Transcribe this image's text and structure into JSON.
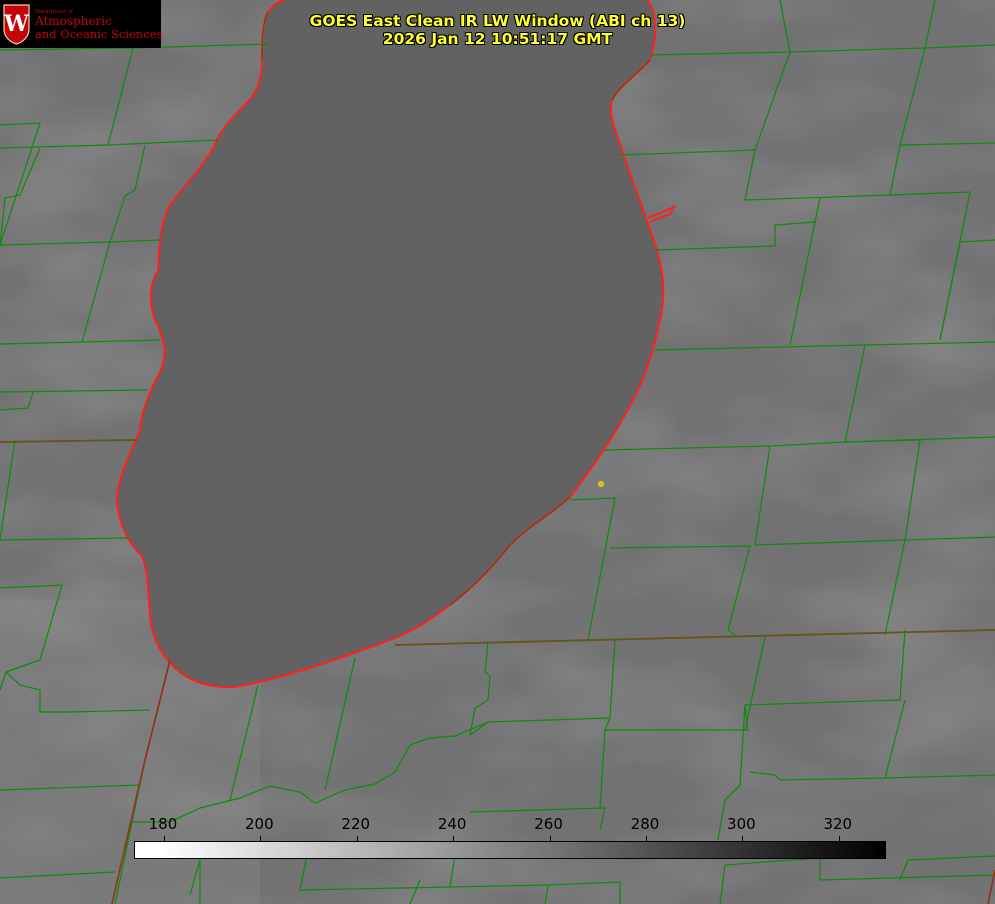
{
  "title_line1": "GOES East Clean IR LW Window (ABI ch 13)",
  "title_line2": "2026 Jan 12 10:51:17 GMT",
  "logo": {
    "department": "Department of",
    "line1": "Atmospheric",
    "line2": "and Oceanic Sciences",
    "seal_letter": "W"
  },
  "colorbar": {
    "ticks": [
      {
        "label": "180",
        "value": 180
      },
      {
        "label": "200",
        "value": 200
      },
      {
        "label": "220",
        "value": 220
      },
      {
        "label": "240",
        "value": 240
      },
      {
        "label": "260",
        "value": 260
      },
      {
        "label": "280",
        "value": 280
      },
      {
        "label": "300",
        "value": 300
      },
      {
        "label": "320",
        "value": 320
      }
    ],
    "min_value": 174,
    "max_value": 330,
    "gradient_from": "#ffffff",
    "gradient_to": "#000000"
  },
  "colors": {
    "title": "#ffff33",
    "lake_outline": "#ff2020",
    "county_lines": "#0f8a0f",
    "state_lines": "#8b3a1a",
    "station_marker": "#d4c21a",
    "lake_fill": "#616161",
    "land_fill": "#747474"
  }
}
